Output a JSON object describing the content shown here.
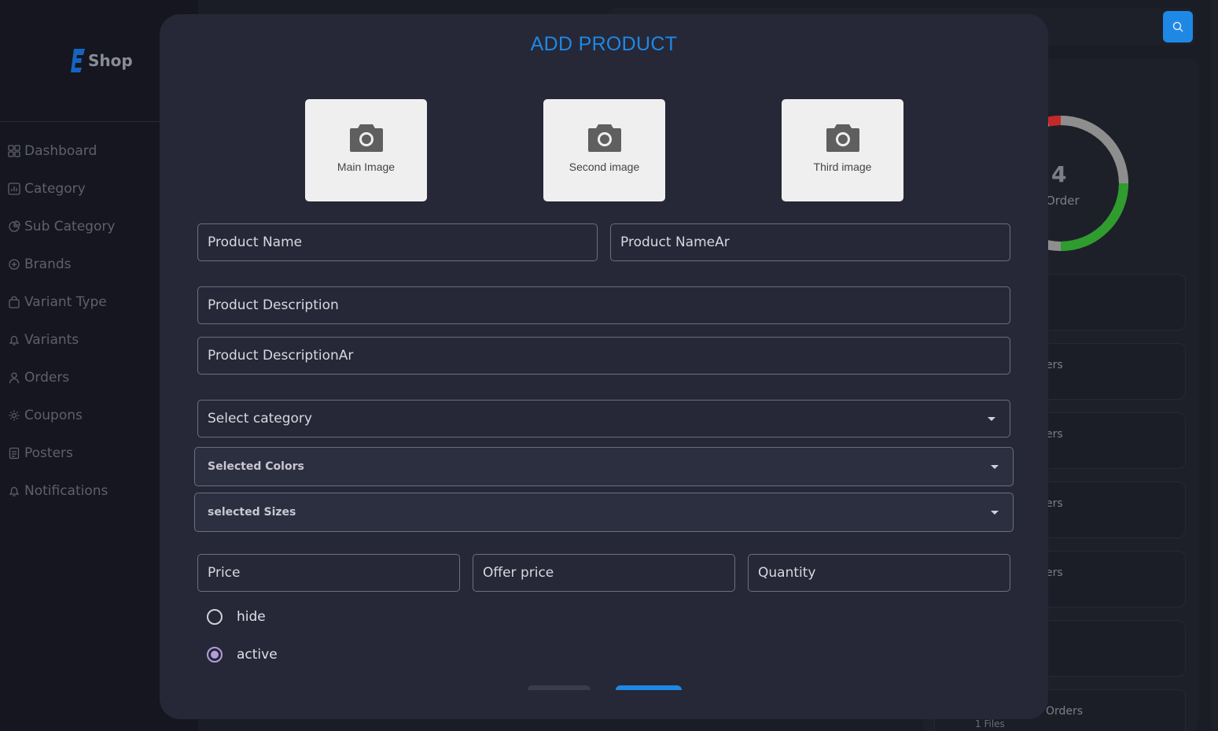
{
  "app": {
    "logo_text": "Shop"
  },
  "sidebar": {
    "items": [
      {
        "label": "Dashboard",
        "icon": "grid-icon"
      },
      {
        "label": "Category",
        "icon": "chart-icon"
      },
      {
        "label": "Sub Category",
        "icon": "pie-icon"
      },
      {
        "label": "Brands",
        "icon": "brand-icon"
      },
      {
        "label": "Variant Type",
        "icon": "bag-icon"
      },
      {
        "label": "Variants",
        "icon": "bell-icon"
      },
      {
        "label": "Orders",
        "icon": "user-icon"
      },
      {
        "label": "Coupons",
        "icon": "gear-icon"
      },
      {
        "label": "Posters",
        "icon": "file-icon"
      },
      {
        "label": "Notifications",
        "icon": "bell-icon"
      }
    ]
  },
  "dashboard": {
    "donut_count": "4",
    "donut_label": "Order",
    "stat_labels": [
      "ers",
      "ers",
      "ers",
      "ers"
    ],
    "bottom_label": "Orders",
    "bottom_sub": "1 Files",
    "colors": {
      "red": "#c62828",
      "gray": "#8e8e8e",
      "green": "#2e9d2e"
    }
  },
  "modal": {
    "title": "ADD PRODUCT",
    "images": [
      "Main Image",
      "Second image",
      "Third image"
    ],
    "fields": {
      "product_name": "Product Name",
      "product_name_ar": "Product NameAr",
      "product_description": "Product Description",
      "product_description_ar": "Product DescriptionAr",
      "category": "Select category",
      "colors": "Selected Colors",
      "sizes": "selected Sizes",
      "price": "Price",
      "offer_price": "Offer price",
      "quantity": "Quantity"
    },
    "status": {
      "options": [
        "hide",
        "active"
      ],
      "selected": "active"
    }
  },
  "theme": {
    "accent": "#1e88e5",
    "radio": "#b39ddb"
  }
}
